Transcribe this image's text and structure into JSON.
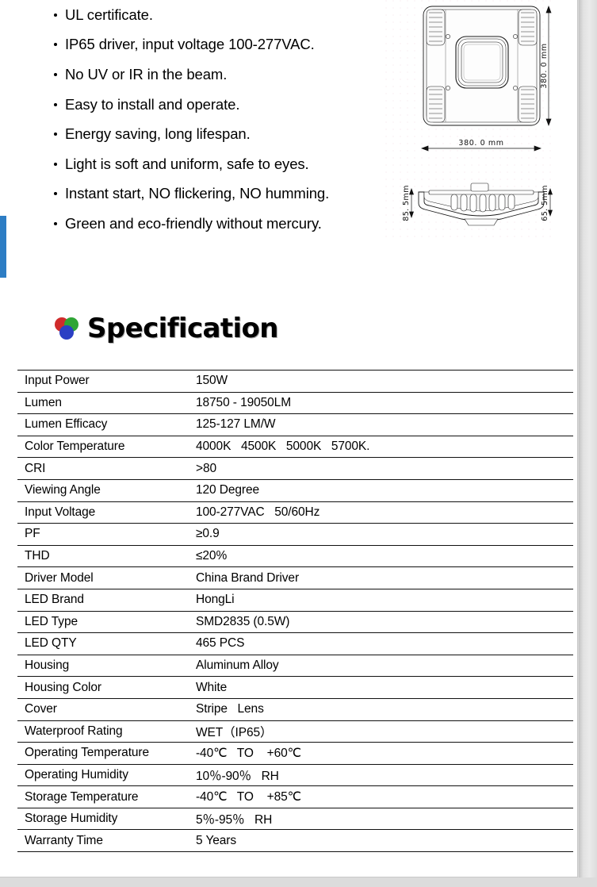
{
  "features": {
    "items": [
      {
        "text": "UL   certificate."
      },
      {
        "text": "IP65 driver, input voltage 100-277VAC."
      },
      {
        "text": "No UV or IR in the beam."
      },
      {
        "text": "Easy to install and operate."
      },
      {
        "text": "Energy saving, long lifespan."
      },
      {
        "text": "Light is soft and uniform, safe to eyes."
      },
      {
        "text": "Instant start, NO flickering, NO humming."
      },
      {
        "text": "Green and eco-friendly without mercury."
      }
    ]
  },
  "drawing": {
    "top_view_label": "top-view-flood-light",
    "side_view_label": "side-view-flood-light",
    "dim_width": "380. 0  mm",
    "dim_height": "380. 0  mm",
    "dim_side_left": "85. 5mm",
    "dim_side_right": "65. 5mm"
  },
  "spec": {
    "heading": "Specification",
    "logo_colors": {
      "red": "#d02b2b",
      "green": "#2fa535",
      "blue": "#2b3fc4"
    },
    "rows": [
      {
        "key": "Input Power",
        "value": "150W"
      },
      {
        "key": "Lumen",
        "value": "18750 - 19050LM"
      },
      {
        "key": "Lumen Efficacy",
        "value": "125-127 LM/W"
      },
      {
        "key": "Color Temperature",
        "value": "4000K   4500K   5000K   5700K."
      },
      {
        "key": "CRI",
        "value": ">80"
      },
      {
        "key": "Viewing Angle",
        "value": "120 Degree"
      },
      {
        "key": "Input Voltage",
        "value": "100-277VAC   50/60Hz"
      },
      {
        "key": "PF",
        "value": "≥0.9"
      },
      {
        "key": "THD",
        "value": "≤20%"
      },
      {
        "key": "Driver Model",
        "value": "China Brand Driver"
      },
      {
        "key": "LED Brand",
        "value": "HongLi"
      },
      {
        "key": "LED Type",
        "value": "SMD2835 (0.5W)"
      },
      {
        "key": "LED QTY",
        "value": "465 PCS"
      },
      {
        "key": "Housing",
        "value": "Aluminum Alloy"
      },
      {
        "key": "Housing Color",
        "value": "White"
      },
      {
        "key": "Cover",
        "value": "Stripe   Lens"
      },
      {
        "key": "Waterproof Rating",
        "value": "WET（IP65）"
      },
      {
        "key": "Operating Temperature",
        "value": "-40℃   TO    +60℃"
      },
      {
        "key": "Operating Humidity",
        "value": "10％-90％   RH"
      },
      {
        "key": "Storage Temperature",
        "value": "-40℃   TO    +85℃"
      },
      {
        "key": "Storage Humidity",
        "value": "5％-95％   RH"
      },
      {
        "key": "Warranty Time",
        "value": "5 Years"
      }
    ]
  },
  "colors": {
    "accent_blue": "#2d7dc4",
    "page_background": "#d9d9d9",
    "sheet_background": "#ffffff",
    "rule": "#111111"
  }
}
